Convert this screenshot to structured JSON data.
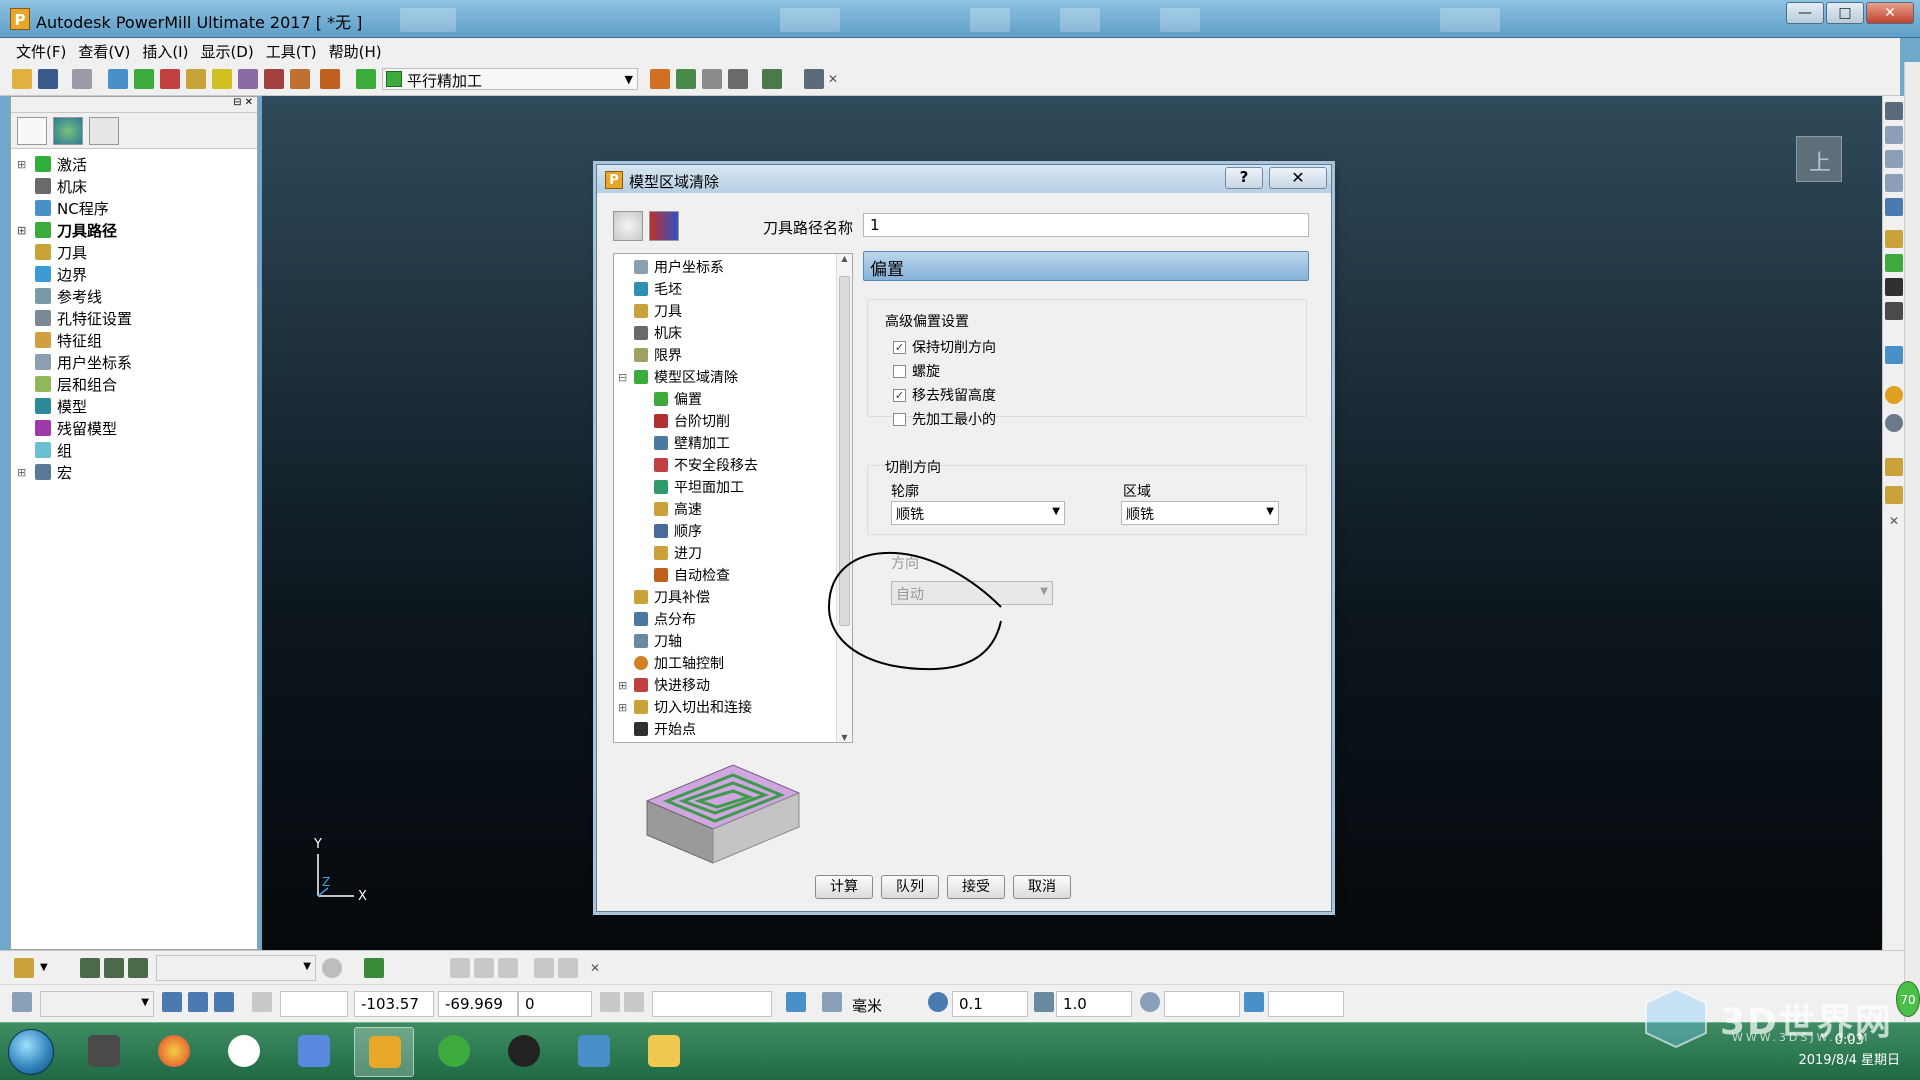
{
  "app": {
    "title": "Autodesk PowerMill Ultimate 2017   [ *无 ]",
    "app_icon_letter": "P"
  },
  "window_controls": {
    "minimize": "—",
    "maximize": "□",
    "close": "✕"
  },
  "menu": [
    "文件(F)",
    "查看(V)",
    "插入(I)",
    "显示(D)",
    "工具(T)",
    "帮助(H)"
  ],
  "toolbar": {
    "strategy_combo": "平行精加工"
  },
  "explorer": {
    "tree": [
      {
        "label": "激活",
        "expander": "⊞",
        "color": "#2fae3a"
      },
      {
        "label": "机床",
        "expander": "",
        "color": "#6a6a6a"
      },
      {
        "label": "NC程序",
        "expander": "",
        "color": "#4a90c8"
      },
      {
        "label": "刀具路径",
        "expander": "⊞",
        "color": "#3caa3c"
      },
      {
        "label": "刀具",
        "expander": "",
        "color": "#c9a23a"
      },
      {
        "label": "边界",
        "expander": "",
        "color": "#3a9bd5"
      },
      {
        "label": "参考线",
        "expander": "",
        "color": "#7a9aa8"
      },
      {
        "label": "孔特征设置",
        "expander": "",
        "color": "#7c8a98"
      },
      {
        "label": "特征组",
        "expander": "",
        "color": "#d0a040"
      },
      {
        "label": "用户坐标系",
        "expander": "",
        "color": "#8aa0b0"
      },
      {
        "label": "层和组合",
        "expander": "",
        "color": "#8fb85a"
      },
      {
        "label": "模型",
        "expander": "",
        "color": "#2c8a9a"
      },
      {
        "label": "残留模型",
        "expander": "",
        "color": "#a03aa8"
      },
      {
        "label": "组",
        "expander": "",
        "color": "#6ac0d0"
      },
      {
        "label": "宏",
        "expander": "⊞",
        "color": "#5a7a9a"
      }
    ]
  },
  "dialog": {
    "title": "模型区域清除",
    "help": "?",
    "close": "✕",
    "toolpath_name_label": "刀具路径名称",
    "toolpath_name_value": "1",
    "tree": [
      {
        "label": "用户坐标系",
        "indent": 1,
        "color": "#8aa0b0"
      },
      {
        "label": "毛坯",
        "indent": 1,
        "color": "#2f8fb0"
      },
      {
        "label": "刀具",
        "indent": 1,
        "color": "#c9a23a"
      },
      {
        "label": "机床",
        "indent": 1,
        "color": "#6a6a6a"
      },
      {
        "label": "限界",
        "indent": 1,
        "color": "#a0a060"
      },
      {
        "label": "模型区域清除",
        "indent": 1,
        "color": "#3caa3c",
        "expander": "⊟"
      },
      {
        "label": "偏置",
        "indent": 2,
        "color": "#3caa3c"
      },
      {
        "label": "台阶切削",
        "indent": 2,
        "color": "#b03030"
      },
      {
        "label": "壁精加工",
        "indent": 2,
        "color": "#4a7aa0"
      },
      {
        "label": "不安全段移去",
        "indent": 2,
        "color": "#c04040"
      },
      {
        "label": "平坦面加工",
        "indent": 2,
        "color": "#2f9a6a"
      },
      {
        "label": "高速",
        "indent": 2,
        "color": "#c9a23a"
      },
      {
        "label": "顺序",
        "indent": 2,
        "color": "#4a6a9a"
      },
      {
        "label": "进刀",
        "indent": 2,
        "color": "#c9a23a"
      },
      {
        "label": "自动检查",
        "indent": 2,
        "color": "#c06020"
      },
      {
        "label": "刀具补偿",
        "indent": 1,
        "color": "#c9a23a"
      },
      {
        "label": "点分布",
        "indent": 1,
        "color": "#4a7aa0"
      },
      {
        "label": "刀轴",
        "indent": 1,
        "color": "#6a8aa0"
      },
      {
        "label": "加工轴控制",
        "indent": 1,
        "color": "#d08020"
      },
      {
        "label": "快进移动",
        "indent": 1,
        "color": "#c04040",
        "expander": "⊞"
      },
      {
        "label": "切入切出和连接",
        "indent": 1,
        "color": "#c9a23a",
        "expander": "⊞"
      },
      {
        "label": "开始点",
        "indent": 1,
        "color": "#303030"
      }
    ],
    "section_title": "偏置",
    "advanced": {
      "title": "高级偏置设置",
      "options": [
        {
          "label": "保持切削方向",
          "checked": "✓"
        },
        {
          "label": "螺旋",
          "checked": ""
        },
        {
          "label": "移去残留高度",
          "checked": "✓"
        },
        {
          "label": "先加工最小的",
          "checked": ""
        }
      ]
    },
    "cut_direction": {
      "title": "切削方向",
      "profile_label": "轮廓",
      "profile_value": "顺铣",
      "area_label": "区域",
      "area_value": "顺铣"
    },
    "direction": {
      "label": "方向",
      "value": "自动"
    },
    "buttons": {
      "calculate": "计算",
      "queue": "队列",
      "accept": "接受",
      "cancel": "取消"
    }
  },
  "viewport": {
    "axis_y": "Y",
    "axis_z": "Z",
    "axis_x": "X",
    "view_cube": "上"
  },
  "status": {
    "x": "-103.57",
    "y": "-69.969",
    "z": "0",
    "units": "毫米",
    "tolerance": "0.1",
    "thickness": "1.0"
  },
  "taskbar": {
    "time": "0:03",
    "date": "2019/8/4 星期日",
    "watermark_big": "3D世界网",
    "watermark_small": "WWW.3DSJW.COM",
    "badge": "70"
  }
}
